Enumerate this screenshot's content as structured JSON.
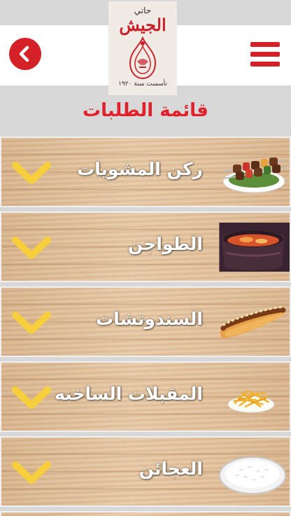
{
  "header": {
    "logo": {
      "top_text": "حاتي",
      "name": "الجيش",
      "bottom_text": "تأسست سنة ١٩٢٠"
    },
    "back_icon": "chevron-left-icon",
    "menu_icon": "hamburger-icon"
  },
  "page": {
    "title": "قائمة الطلبات"
  },
  "menu": {
    "items": [
      {
        "label": "ركن المشويات",
        "image": "grill-skewers-image",
        "icon": "chevron-down-icon"
      },
      {
        "label": "الطواجن",
        "image": "clay-pot-tagine-image",
        "icon": "chevron-down-icon"
      },
      {
        "label": "السندوتشات",
        "image": "sandwich-image",
        "icon": "chevron-down-icon"
      },
      {
        "label": "المقبلات الساخنه",
        "image": "french-fries-image",
        "icon": "chevron-down-icon"
      },
      {
        "label": "العجائن",
        "image": "rice-plate-image",
        "icon": "chevron-down-icon"
      }
    ]
  },
  "colors": {
    "brand_red": "#d42027",
    "title_red": "#e0202a",
    "chevron_yellow": "#f7cf3c",
    "wood": "#e2c29c"
  }
}
